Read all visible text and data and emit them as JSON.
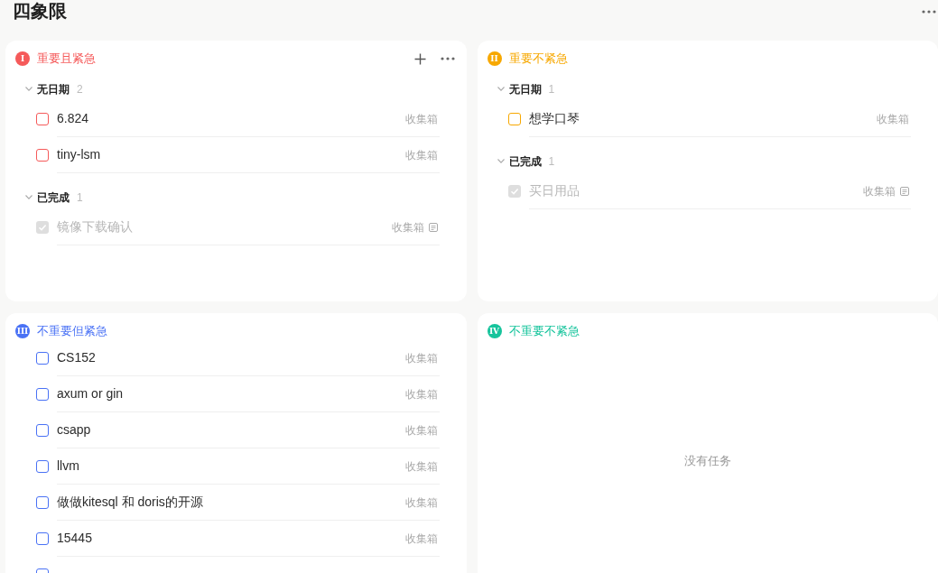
{
  "header": {
    "title": "四象限"
  },
  "quadrants": [
    {
      "kind": "grouped",
      "badge": "I",
      "title": "重要且紧急",
      "color": "#f55a5a",
      "hovered": true,
      "groups": [
        {
          "title": "无日期",
          "count": "2",
          "expanded": true,
          "tasks": [
            {
              "title": "6.824",
              "list": "收集箱",
              "checked": false,
              "note": false
            },
            {
              "title": "tiny-lsm",
              "list": "收集箱",
              "checked": false,
              "note": false
            }
          ]
        },
        {
          "title": "已完成",
          "count": "1",
          "expanded": true,
          "tasks": [
            {
              "title": "镜像下载确认",
              "list": "收集箱",
              "checked": true,
              "note": true
            }
          ]
        }
      ]
    },
    {
      "kind": "grouped",
      "badge": "II",
      "title": "重要不紧急",
      "color": "#f7a800",
      "hovered": false,
      "groups": [
        {
          "title": "无日期",
          "count": "1",
          "expanded": true,
          "tasks": [
            {
              "title": "想学口琴",
              "list": "收集箱",
              "checked": false,
              "note": false
            }
          ]
        },
        {
          "title": "已完成",
          "count": "1",
          "expanded": true,
          "tasks": [
            {
              "title": "买日用品",
              "list": "收集箱",
              "checked": true,
              "note": true
            }
          ]
        }
      ]
    },
    {
      "kind": "flat",
      "badge": "III",
      "title": "不重要但紧急",
      "color": "#4a72f5",
      "hovered": false,
      "tasks": [
        {
          "title": "CS152",
          "list": "收集箱",
          "checked": false,
          "note": false
        },
        {
          "title": "axum or gin",
          "list": "收集箱",
          "checked": false,
          "note": false
        },
        {
          "title": "csapp",
          "list": "收集箱",
          "checked": false,
          "note": false
        },
        {
          "title": "llvm",
          "list": "收集箱",
          "checked": false,
          "note": false
        },
        {
          "title": "做做kitesql 和 doris的开源",
          "list": "收集箱",
          "checked": false,
          "note": false
        },
        {
          "title": "15445",
          "list": "收集箱",
          "checked": false,
          "note": false
        },
        {
          "checked": false,
          "note": false
        }
      ]
    },
    {
      "kind": "empty",
      "badge": "IV",
      "title": "不重要不紧急",
      "color": "#16c49c",
      "hovered": false,
      "empty_text": "没有任务"
    }
  ]
}
